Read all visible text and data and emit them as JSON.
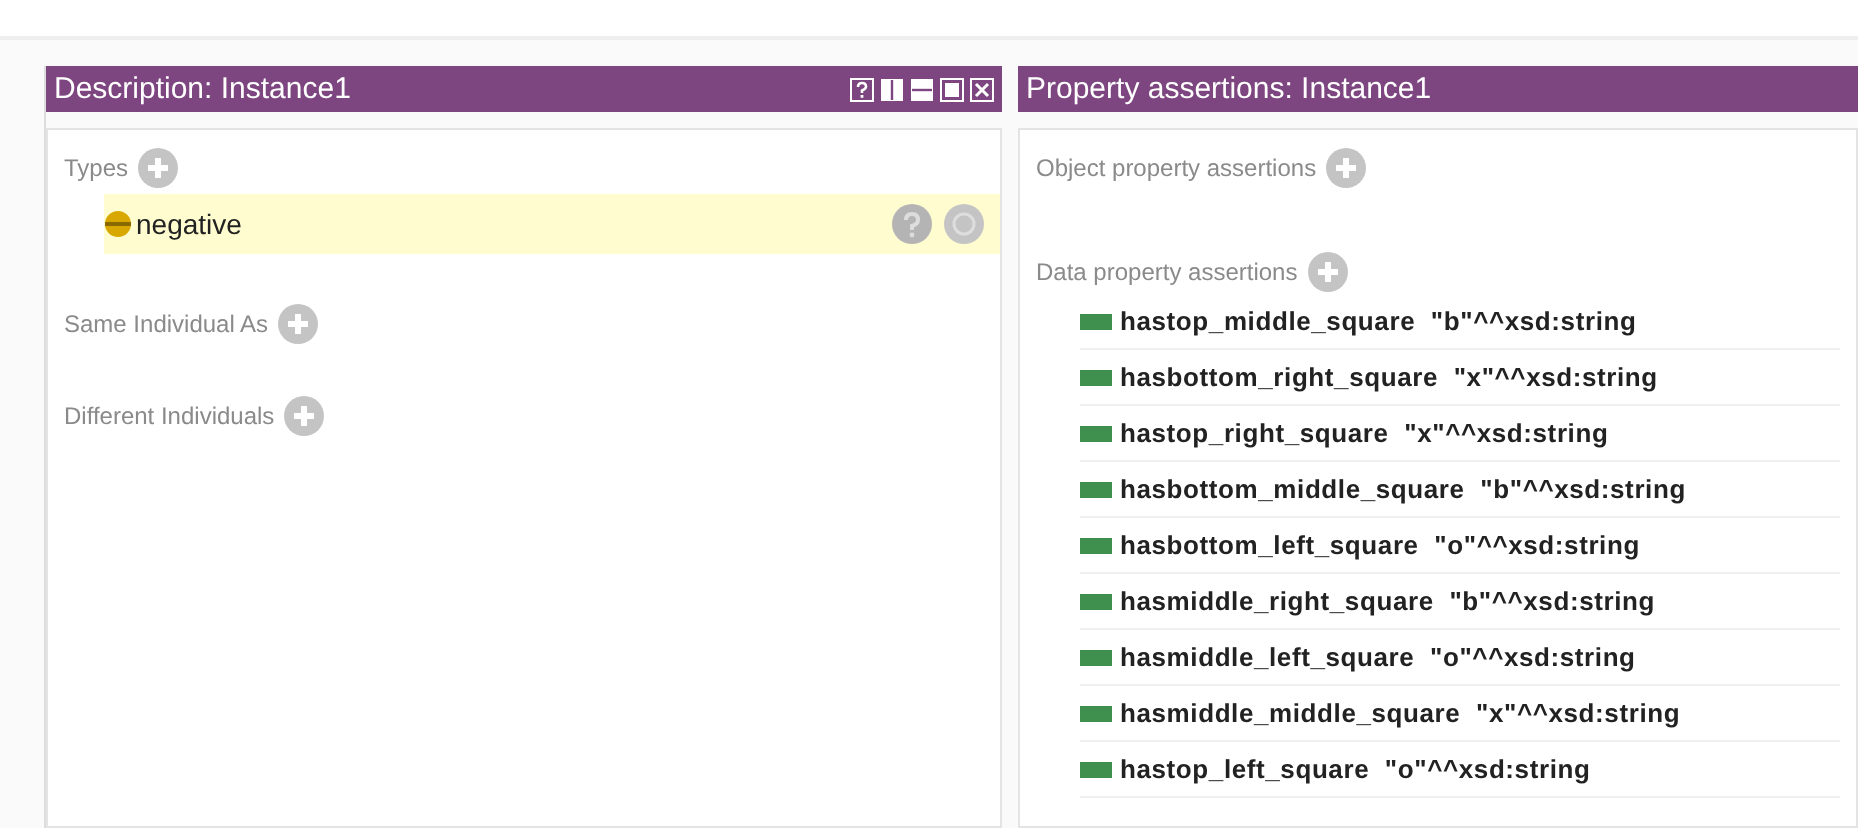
{
  "description_panel": {
    "title": "Description: Instance1",
    "sections": [
      {
        "label": "Types",
        "items": [
          {
            "label": "negative",
            "selected": true
          }
        ]
      },
      {
        "label": "Same Individual As"
      },
      {
        "label": "Different Individuals"
      }
    ]
  },
  "assertions_panel": {
    "title": "Property assertions: Instance1",
    "object_label": "Object property assertions",
    "data_label": "Data property assertions",
    "data_items": [
      {
        "text": "hastop_middle_square  \"b\"^^xsd:string"
      },
      {
        "text": "hasbottom_right_square  \"x\"^^xsd:string"
      },
      {
        "text": "hastop_right_square  \"x\"^^xsd:string"
      },
      {
        "text": "hasbottom_middle_square  \"b\"^^xsd:string"
      },
      {
        "text": "hasbottom_left_square  \"o\"^^xsd:string"
      },
      {
        "text": "hasmiddle_right_square  \"b\"^^xsd:string"
      },
      {
        "text": "hasmiddle_left_square  \"o\"^^xsd:string"
      },
      {
        "text": "hasmiddle_middle_square  \"x\"^^xsd:string"
      },
      {
        "text": "hastop_left_square  \"o\"^^xsd:string"
      }
    ]
  }
}
